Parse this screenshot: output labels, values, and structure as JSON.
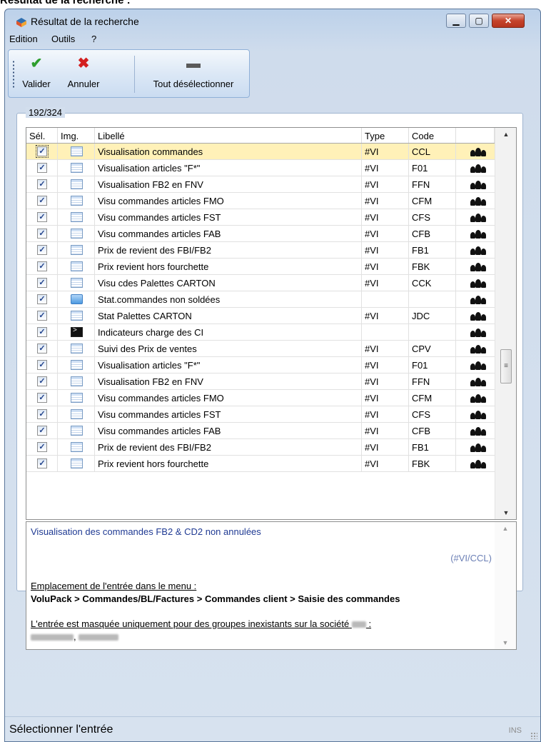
{
  "page_heading": "Résultat de la recherche :",
  "window": {
    "title": "Résultat de la recherche",
    "minimize": "▁",
    "maximize": "▢",
    "close": "✕"
  },
  "menu": {
    "items": [
      "Edition",
      "Outils",
      "?"
    ]
  },
  "toolbar": {
    "validate_label": "Valider",
    "cancel_label": "Annuler",
    "deselect_label": "Tout désélectionner",
    "validate_icon": "✔",
    "cancel_icon": "✖",
    "deselect_icon": "▬",
    "colors": {
      "validate": "#2e9e2e",
      "cancel": "#d31f1f",
      "deselect": "#5a5a5a"
    }
  },
  "group_label": "192/324",
  "table": {
    "headers": {
      "sel": "Sél.",
      "img": "Img.",
      "label": "Libellé",
      "type": "Type",
      "code": "Code"
    },
    "rows": [
      {
        "label": "Visualisation commandes",
        "type": "#VI",
        "code": "CCL",
        "icon": "list-icon",
        "checked": true,
        "selected": true
      },
      {
        "label": "Visualisation articles \"F*\"",
        "type": "#VI",
        "code": "F01",
        "icon": "list-icon",
        "checked": true
      },
      {
        "label": "Visualisation FB2 en FNV",
        "type": "#VI",
        "code": "FFN",
        "icon": "list-icon",
        "checked": true
      },
      {
        "label": "Visu commandes articles FMO",
        "type": "#VI",
        "code": "CFM",
        "icon": "list-icon",
        "checked": true
      },
      {
        "label": "Visu commandes articles FST",
        "type": "#VI",
        "code": "CFS",
        "icon": "list-icon",
        "checked": true
      },
      {
        "label": "Visu commandes articles FAB",
        "type": "#VI",
        "code": "CFB",
        "icon": "list-icon",
        "checked": true
      },
      {
        "label": "Prix de revient des FBI/FB2",
        "type": "#VI",
        "code": "FB1",
        "icon": "list-icon",
        "checked": true
      },
      {
        "label": "Prix revient hors fourchette",
        "type": "#VI",
        "code": "FBK",
        "icon": "list-icon",
        "checked": true
      },
      {
        "label": "Visu cdes Palettes CARTON",
        "type": "#VI",
        "code": "CCK",
        "icon": "list-icon",
        "checked": true
      },
      {
        "label": "Stat.commandes non soldées",
        "type": "",
        "code": "",
        "icon": "folder-icon",
        "checked": true
      },
      {
        "label": "Stat Palettes CARTON",
        "type": "#VI",
        "code": "JDC",
        "icon": "list-icon",
        "checked": true
      },
      {
        "label": "Indicateurs charge des CI",
        "type": "",
        "code": "",
        "icon": "terminal-icon",
        "checked": true
      },
      {
        "label": "Suivi des Prix de ventes",
        "type": "#VI",
        "code": "CPV",
        "icon": "list-icon",
        "checked": true
      },
      {
        "label": "Visualisation articles \"F*\"",
        "type": "#VI",
        "code": "F01",
        "icon": "list-icon",
        "checked": true
      },
      {
        "label": "Visualisation FB2 en FNV",
        "type": "#VI",
        "code": "FFN",
        "icon": "list-icon",
        "checked": true
      },
      {
        "label": "Visu commandes articles FMO",
        "type": "#VI",
        "code": "CFM",
        "icon": "list-icon",
        "checked": true
      },
      {
        "label": "Visu commandes articles FST",
        "type": "#VI",
        "code": "CFS",
        "icon": "list-icon",
        "checked": true
      },
      {
        "label": "Visu commandes articles FAB",
        "type": "#VI",
        "code": "CFB",
        "icon": "list-icon",
        "checked": true
      },
      {
        "label": "Prix de revient des FBI/FB2",
        "type": "#VI",
        "code": "FB1",
        "icon": "list-icon",
        "checked": true
      },
      {
        "label": "Prix revient hors fourchette",
        "type": "#VI",
        "code": "FBK",
        "icon": "list-icon",
        "checked": true
      }
    ],
    "check_glyph": "✓",
    "group_icon": "users-group-icon",
    "selected_row_color": "#fff1b8"
  },
  "description": {
    "first_line": "Visualisation des commandes FB2 & CD2 non annulées",
    "code_ref": "(#VI/CCL)",
    "location_heading": "Emplacement de l'entrée dans le menu :",
    "location_path": "VoluPack > Commandes/BL/Factures > Commandes client > Saisie des commandes",
    "hidden_text": "L'entrée est masquée uniquement pour des groupes inexistants sur la société",
    "hidden_suffix": " :",
    "groups_separator": ", "
  },
  "status": {
    "text": "Sélectionner l'entrée",
    "mode": "INS"
  },
  "scroll": {
    "up": "▲",
    "down": "▼",
    "thumb": "≡"
  }
}
